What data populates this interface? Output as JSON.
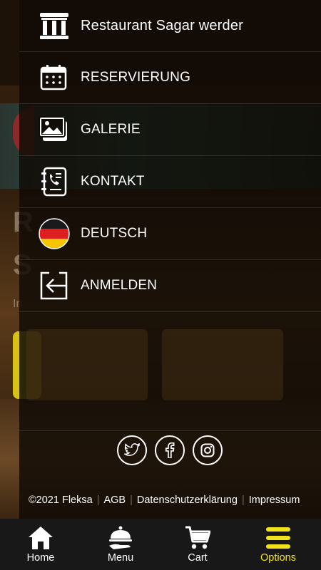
{
  "drawer": {
    "items": [
      {
        "label": "Restaurant Sagar werder",
        "icon": "restaurant-building-icon"
      },
      {
        "label": "RESERVIERUNG",
        "icon": "calendar-icon"
      },
      {
        "label": "GALERIE",
        "icon": "gallery-icon"
      },
      {
        "label": "KONTAKT",
        "icon": "contact-book-icon"
      },
      {
        "label": "DEUTSCH",
        "icon": "germany-flag-icon"
      },
      {
        "label": "ANMELDEN",
        "icon": "login-icon"
      }
    ]
  },
  "social": {
    "items": [
      {
        "name": "twitter",
        "icon": "twitter-icon"
      },
      {
        "name": "facebook",
        "icon": "facebook-icon"
      },
      {
        "name": "instagram",
        "icon": "instagram-icon"
      }
    ]
  },
  "footer": {
    "copyright": "©2021 Fleksa",
    "agb": "AGB",
    "privacy": "Datenschutzerklärung",
    "imprint": "Impressum"
  },
  "bottom_nav": {
    "items": [
      {
        "label": "Home",
        "icon": "home-icon",
        "active": false
      },
      {
        "label": "Menu",
        "icon": "serving-cloche-icon",
        "active": false
      },
      {
        "label": "Cart",
        "icon": "cart-icon",
        "active": false
      },
      {
        "label": "Options",
        "icon": "hamburger-menu-icon",
        "active": true
      }
    ]
  },
  "colors": {
    "accent": "#f1e21a",
    "nav_background": "#181818",
    "text": "#ffffff"
  }
}
